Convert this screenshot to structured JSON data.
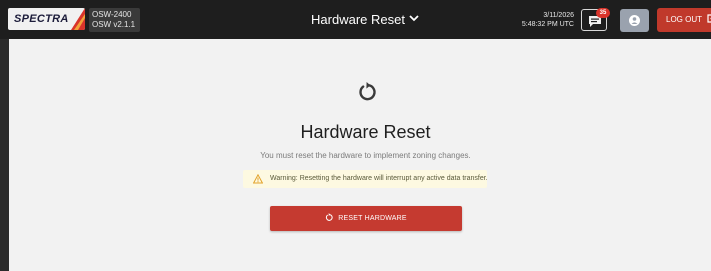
{
  "header": {
    "logo_text": "SPECTRA",
    "device": {
      "model": "OSW-2400",
      "version": "OSW v2.1.1"
    },
    "page_menu_label": "Hardware Reset",
    "date": "3/11/2026",
    "time": "5:48:32 PM UTC",
    "messages_badge": "35",
    "logout_label": "LOG OUT"
  },
  "main": {
    "title": "Hardware Reset",
    "subtitle": "You must reset the hardware to implement zoning changes.",
    "warning_text": "Warning: Resetting the hardware will interrupt any active data transfer.",
    "reset_button_label": "RESET HARDWARE"
  },
  "colors": {
    "topbar": "#1e1e1e",
    "danger": "#c53a30",
    "warning_bg": "#fdf9e1",
    "content_bg": "#f2f2f2"
  },
  "icons": {
    "page_menu": "chevron-down-icon",
    "messages": "message-icon",
    "user": "user-icon",
    "logout": "logout-icon",
    "reset": "reset-icon",
    "warning": "warning-icon"
  }
}
